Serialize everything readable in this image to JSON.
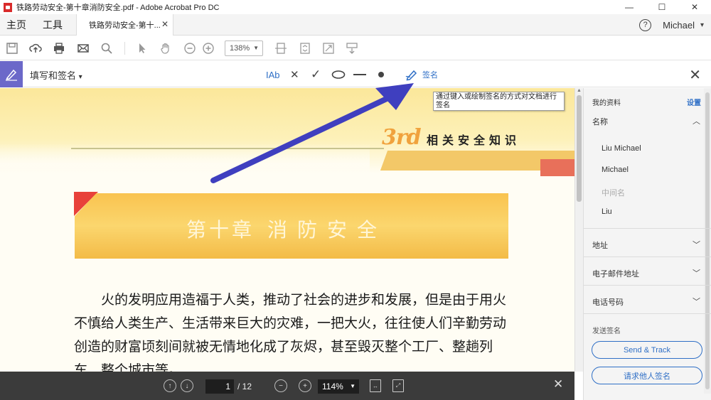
{
  "window": {
    "title": "铁路劳动安全-第十章消防安全.pdf - Adobe Acrobat Pro DC",
    "minimize": "—",
    "maximize": "☐",
    "close": "✕"
  },
  "menubar": {
    "home": "主页",
    "tools": "工具",
    "doc_tab": "铁路劳动安全-第十...",
    "doc_tab_close": "✕",
    "help": "?",
    "user": "Michael"
  },
  "toolbar": {
    "zoom": "138%"
  },
  "signbar": {
    "mode": "填写和签名",
    "mode_chevron": "▾",
    "text_tool": "Ab",
    "cross_tool": "✕",
    "check_tool": "✓",
    "sign_label": "签名",
    "close": "✕"
  },
  "tooltip": {
    "text": "通过键入或绘制签名的方式对文档进行签名"
  },
  "document": {
    "header_3rd": "3rd",
    "header_title": "相关安全知识",
    "chapter_label": "第十章",
    "chapter_name": "消防安全",
    "paragraph": "火的发明应用造福于人类，推动了社会的进步和发展，但是由于用火不慎给人类生产、生活带来巨大的灾难，一把大火，往往使人们辛勤劳动创造的财富顷刻间就被无情地化成了灰烬，甚至毁灭整个工厂、整趟列车、整个城市等。"
  },
  "pagenav": {
    "current_page": "1",
    "total": "/ 12",
    "zoom": "114%",
    "close": "✕"
  },
  "rightpanel": {
    "my_profile": "我的资料",
    "settings": "设置",
    "name_section": "名称",
    "full_name": "Liu Michael",
    "first_name": "Michael",
    "middle_name": "中间名",
    "last_name": "Liu",
    "address": "地址",
    "email": "电子邮件地址",
    "phone": "电话号码",
    "send_label": "发送签名",
    "send_track": "Send & Track",
    "request_sign": "请求他人签名"
  },
  "colors": {
    "sign_accent": "#6b68c9",
    "arrow": "#3f3fbf",
    "link_blue": "#2f6fc6",
    "banner_yellow": "#f9c34f",
    "nav_dark": "#3b3b3b"
  }
}
